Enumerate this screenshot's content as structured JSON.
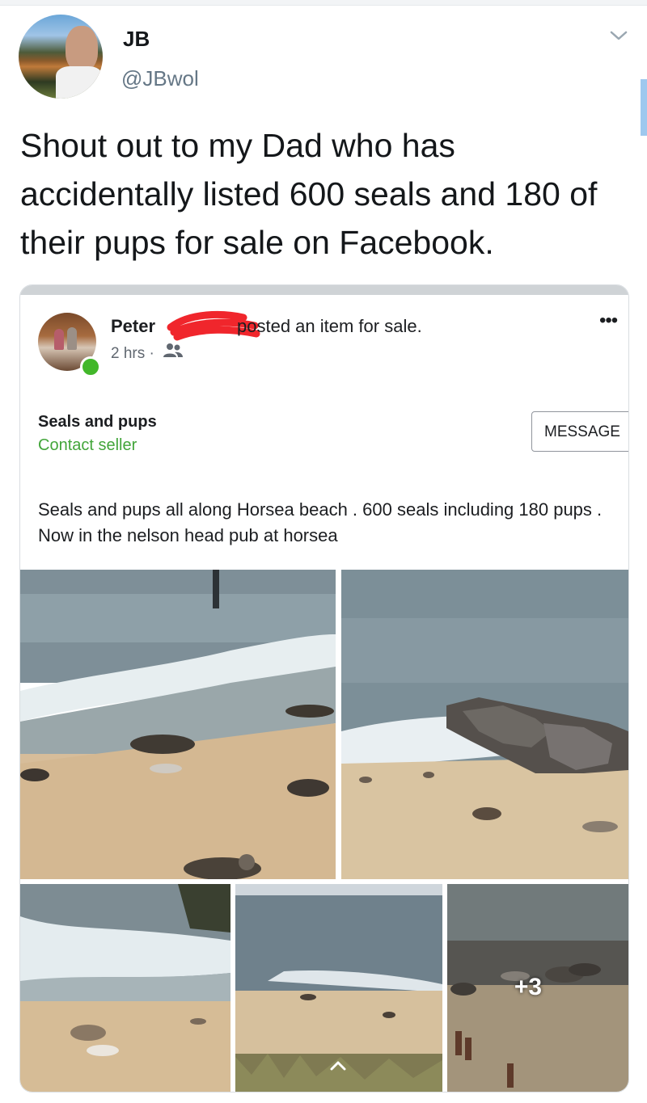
{
  "tweet": {
    "author": {
      "name": "JB",
      "handle": "@JBwol"
    },
    "text": "Shout out to my Dad who has accidentally listed 600 seals and 180 of their pups for sale on Facebook."
  },
  "fb_post": {
    "poster_name": "Peter",
    "action_text": "posted an item for sale.",
    "time": "2 hrs ·",
    "more_label": "•••",
    "item_title": "Seals and pups",
    "contact_label": "Contact seller",
    "message_button": "MESSAGE",
    "description": "Seals and pups all along Horsea beach . 600 seals including 180 pups . Now in the nelson head pub at horsea",
    "more_photos": "+3"
  },
  "colors": {
    "handle_gray": "#657786",
    "fb_green": "#42a53a",
    "online_green": "#42b72a",
    "redaction_red": "#f0262c"
  },
  "icons": [
    "chevron-down-icon",
    "friends-icon",
    "more-options-icon",
    "chevron-up-icon"
  ]
}
